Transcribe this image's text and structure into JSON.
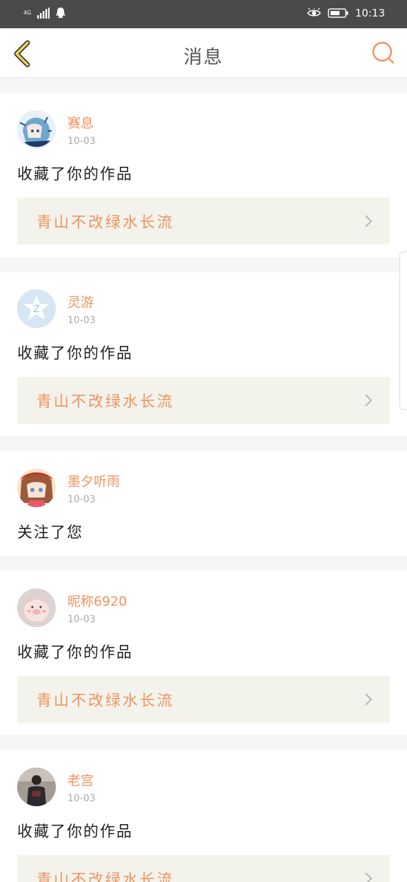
{
  "status_bar": {
    "network": "4G",
    "time": "10:13"
  },
  "header": {
    "title": "消息",
    "back_icon": "chevron-left-icon",
    "search_icon": "search-icon"
  },
  "colors": {
    "accent": "#ef935f",
    "back_yellow": "#f2d25a",
    "card_link_bg": "#f3f3ec"
  },
  "messages": [
    {
      "username": "赛息",
      "date": "10-03",
      "action": "收藏了你的作品",
      "work_title": "青山不改绿水长流",
      "avatar": "anime-character-avatar"
    },
    {
      "username": "灵游",
      "date": "10-03",
      "action": "收藏了你的作品",
      "work_title": "青山不改绿水长流",
      "avatar": "default-star-avatar"
    },
    {
      "username": "墨夕听雨",
      "date": "10-03",
      "action": "关注了您",
      "work_title": "",
      "avatar": "anime-girl-avatar"
    },
    {
      "username": "昵称6920",
      "date": "10-03",
      "action": "收藏了你的作品",
      "work_title": "青山不改绿水长流",
      "avatar": "pig-avatar"
    },
    {
      "username": "老宫",
      "date": "10-03",
      "action": "收藏了你的作品",
      "work_title": "青山不改绿水长流",
      "avatar": "person-photo-avatar"
    }
  ]
}
